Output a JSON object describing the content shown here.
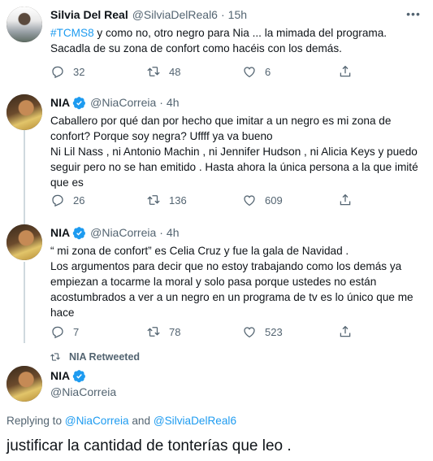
{
  "tweets": [
    {
      "name": "Silvia Del Real",
      "handle": "@SilviaDelReal6",
      "time": "15h",
      "hashtag": "#TCMS8",
      "text_after_hashtag": " y como no, otro negro para Nia ... la mimada del programa.",
      "lines": [
        "Sacadla de su zona de confort como hacéis con los demás."
      ],
      "replies": "32",
      "retweets": "48",
      "likes": "6"
    },
    {
      "name": "NIA",
      "handle": "@NiaCorreia",
      "time": "4h",
      "lines": [
        "Caballero por qué dan por hecho que imitar a un negro es mi zona de",
        "confort? Porque soy negra? Uffff ya va bueno",
        "Ni Lil Nass , ni Antonio Machin , ni Jennifer Hudson , ni Alicia Keys y puedo",
        "seguir pero no se han emitido . Hasta ahora la única persona a la que imité",
        "que es"
      ],
      "replies": "26",
      "retweets": "136",
      "likes": "609"
    },
    {
      "name": "NIA",
      "handle": "@NiaCorreia",
      "time": "4h",
      "lines": [
        "“ mi zona de confort” es Celia Cruz y fue la gala de Navidad .",
        "Los argumentos para decir que no estoy trabajando como los demás ya",
        "empiezan a tocarme la moral y solo pasa porque ustedes no están",
        "acostumbrados a ver a un negro en un programa de tv es lo único que me",
        "hace"
      ],
      "replies": "7",
      "retweets": "78",
      "likes": "523"
    }
  ],
  "retweeted_label": "NIA Retweeted",
  "focus": {
    "name": "NIA",
    "handle": "@NiaCorreia",
    "replying_prefix": "Replying to ",
    "replying_user1": "@NiaCorreia",
    "replying_and": " and ",
    "replying_user2": "@SilviaDelReal6",
    "text": "justificar la cantidad de tonterías que leo ."
  },
  "colors": {
    "accent": "#1d9bf0",
    "secondary_text": "#536471",
    "thread_line": "#cfd9de"
  },
  "icons": [
    "more-icon",
    "verified-badge-icon",
    "reply-icon",
    "retweet-icon",
    "like-icon",
    "share-icon"
  ]
}
